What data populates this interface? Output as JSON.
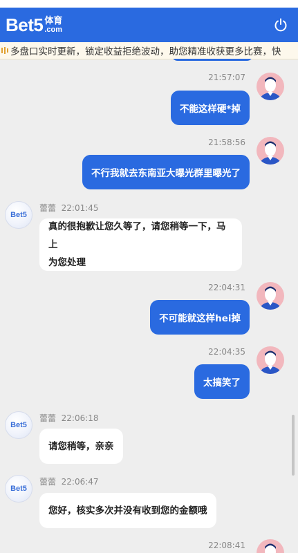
{
  "header": {
    "logo_main": "Bet5",
    "logo_cn": "体育",
    "logo_com": ".com",
    "power_icon": "power-icon",
    "color": "#2a6ae0"
  },
  "marquee": {
    "text": "多盘口实时更新，锁定收益拒绝波动，助您精准收获更多比赛，快"
  },
  "agent": {
    "avatar_text": "Bet5",
    "name": "蕾蕾"
  },
  "messages": [
    {
      "side": "user",
      "time": "21:57:07",
      "text": "不能这样硬*掉"
    },
    {
      "side": "user",
      "time": "21:58:56",
      "text": "不行我就去东南亚大曝光群里曝光了"
    },
    {
      "side": "agent",
      "time": "22:01:45",
      "lines": [
        "真的很抱歉让您久等了，请您稍等一下，马上",
        "为您处理"
      ]
    },
    {
      "side": "user",
      "time": "22:04:31",
      "text": "不可能就这样hei掉"
    },
    {
      "side": "user",
      "time": "22:04:35",
      "text": "太搞笑了"
    },
    {
      "side": "agent",
      "time": "22:06:18",
      "lines": [
        "请您稍等，亲亲"
      ]
    },
    {
      "side": "agent",
      "time": "22:06:47",
      "lines": [
        "您好，核实多次并没有收到您的金额哦"
      ]
    },
    {
      "side": "user",
      "time": "22:08:41",
      "text": ""
    }
  ]
}
